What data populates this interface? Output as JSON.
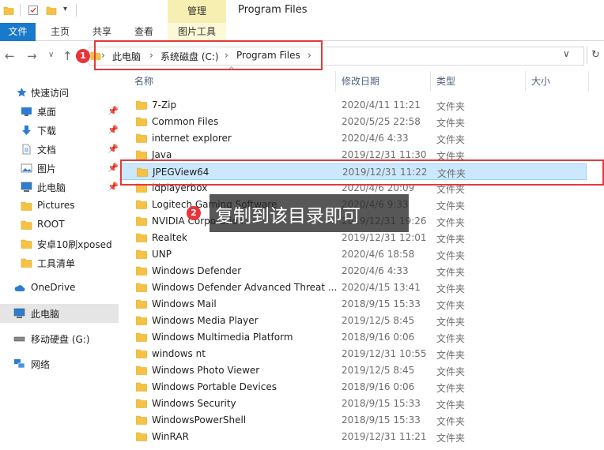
{
  "window": {
    "title": "Program Files",
    "manage_tab": "管理"
  },
  "ribbon": {
    "tabs": [
      "文件",
      "主页",
      "共享",
      "查看",
      "图片工具"
    ]
  },
  "address": {
    "crumbs": [
      "此电脑",
      "系统磁盘 (C:)",
      "Program Files"
    ],
    "badge": "1"
  },
  "sidebar": {
    "items": [
      {
        "label": "快速访问",
        "icon": "star-icon",
        "pinned": false
      },
      {
        "label": "桌面",
        "icon": "desktop-icon",
        "pinned": true
      },
      {
        "label": "下载",
        "icon": "download-icon",
        "pinned": true
      },
      {
        "label": "文档",
        "icon": "document-icon",
        "pinned": true
      },
      {
        "label": "图片",
        "icon": "picture-icon",
        "pinned": true
      },
      {
        "label": "此电脑",
        "icon": "computer-icon",
        "pinned": true
      },
      {
        "label": "Pictures",
        "icon": "folder-icon",
        "pinned": false
      },
      {
        "label": "ROOT",
        "icon": "folder-icon",
        "pinned": false
      },
      {
        "label": "安卓10刷xposed",
        "icon": "folder-icon",
        "pinned": false
      },
      {
        "label": "工具清单",
        "icon": "folder-icon",
        "pinned": false
      },
      {
        "label": "OneDrive",
        "icon": "cloud-icon",
        "pinned": false
      },
      {
        "label": "此电脑",
        "icon": "computer-icon",
        "pinned": false
      },
      {
        "label": "移动硬盘 (G:)",
        "icon": "drive-icon",
        "pinned": false
      },
      {
        "label": "网络",
        "icon": "network-icon",
        "pinned": false
      }
    ]
  },
  "columns": {
    "name": "名称",
    "modified": "修改日期",
    "type": "类型",
    "size": "大小"
  },
  "files": [
    {
      "name": "7-Zip",
      "date": "2020/4/11 11:21",
      "type": "文件夹"
    },
    {
      "name": "Common Files",
      "date": "2020/5/25 22:58",
      "type": "文件夹"
    },
    {
      "name": "internet explorer",
      "date": "2020/4/6 4:33",
      "type": "文件夹"
    },
    {
      "name": "Java",
      "date": "2019/12/31 11:30",
      "type": "文件夹"
    },
    {
      "name": "JPEGView64",
      "date": "2019/12/31 11:22",
      "type": "文件夹"
    },
    {
      "name": "ldplayerbox",
      "date": "2020/4/6 20:09",
      "type": "文件夹"
    },
    {
      "name": "Logitech Gaming Software",
      "date": "2020/4/6 9:33",
      "type": "文件夹"
    },
    {
      "name": "NVIDIA Corporation",
      "date": "2019/12/31 19:26",
      "type": "文件夹"
    },
    {
      "name": "Realtek",
      "date": "2019/12/31 12:01",
      "type": "文件夹"
    },
    {
      "name": "UNP",
      "date": "2020/4/6 18:58",
      "type": "文件夹"
    },
    {
      "name": "Windows Defender",
      "date": "2020/4/6 4:33",
      "type": "文件夹"
    },
    {
      "name": "Windows Defender Advanced Threat ...",
      "date": "2020/4/15 13:41",
      "type": "文件夹"
    },
    {
      "name": "Windows Mail",
      "date": "2018/9/15 15:33",
      "type": "文件夹"
    },
    {
      "name": "Windows Media Player",
      "date": "2019/12/5 8:45",
      "type": "文件夹"
    },
    {
      "name": "Windows Multimedia Platform",
      "date": "2018/9/16 0:06",
      "type": "文件夹"
    },
    {
      "name": "windows nt",
      "date": "2019/12/31 10:55",
      "type": "文件夹"
    },
    {
      "name": "Windows Photo Viewer",
      "date": "2019/12/5 8:45",
      "type": "文件夹"
    },
    {
      "name": "Windows Portable Devices",
      "date": "2018/9/16 0:06",
      "type": "文件夹"
    },
    {
      "name": "Windows Security",
      "date": "2018/9/15 15:33",
      "type": "文件夹"
    },
    {
      "name": "WindowsPowerShell",
      "date": "2018/9/15 15:33",
      "type": "文件夹"
    },
    {
      "name": "WinRAR",
      "date": "2019/12/31 11:21",
      "type": "文件夹"
    }
  ],
  "selected_file": "JPEGView64",
  "annotation": {
    "badge": "2",
    "text": "复制到该目录即可"
  },
  "colors": {
    "accent": "#1979ca",
    "annotation_red": "#e33a3a",
    "selection": "#cce8ff",
    "folder": "#f5c242"
  }
}
